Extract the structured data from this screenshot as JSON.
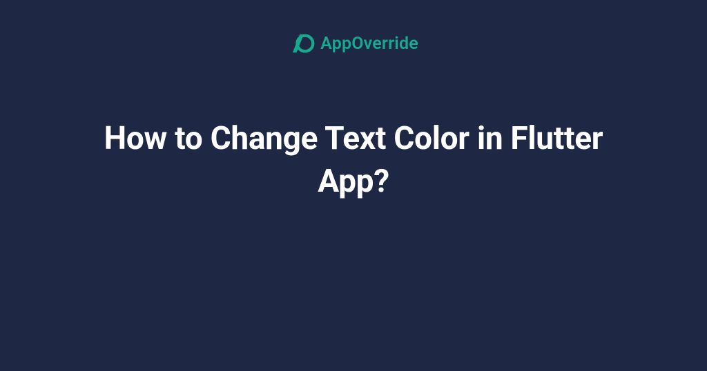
{
  "brand": {
    "name": "AppOverride",
    "accent_color": "#1aa88f"
  },
  "title": "How to Change Text Color in Flutter App?",
  "background_color": "#1e2844",
  "text_color": "#ffffff"
}
